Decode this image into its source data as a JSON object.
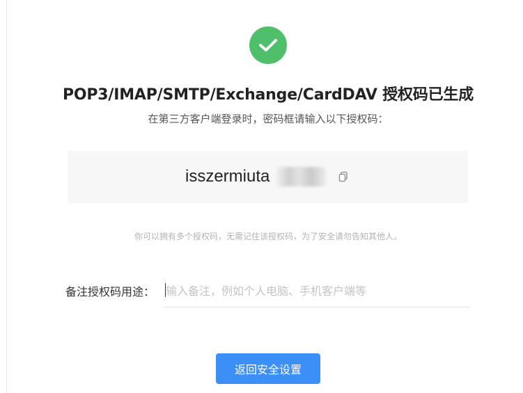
{
  "status": {
    "icon": "checkmark-icon",
    "color": "#4fbf6b"
  },
  "title": "POP3/IMAP/SMTP/Exchange/CardDAV 授权码已生成",
  "subtitle": "在第三方客户端登录时，密码框请输入以下授权码：",
  "auth_code": {
    "visible": "isszermiuta",
    "copy_icon": "copy-icon"
  },
  "tip": "你可以拥有多个授权码，无需记住该授权码，为了安全请勿告知其他人。",
  "remark": {
    "label": "备注授权码用途：",
    "placeholder": "输入备注，例如个人电脑、手机客户端等",
    "value": ""
  },
  "back_button": {
    "label": "返回安全设置",
    "color": "#3b8ff6"
  }
}
